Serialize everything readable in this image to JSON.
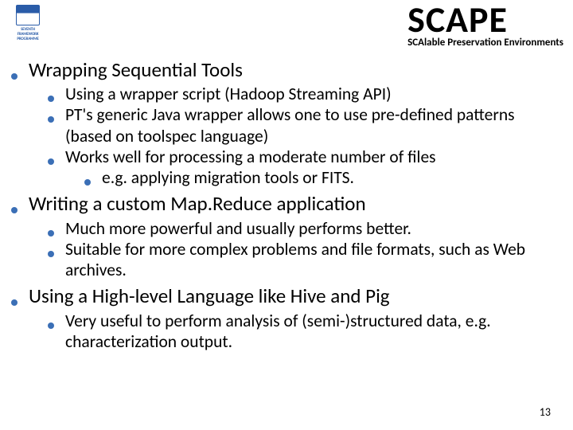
{
  "header": {
    "title": "SCAPE",
    "subtitle": "SCAlable Preservation Environments",
    "logo_caption": "SEVENTH FRAMEWORK PROGRAMME"
  },
  "items": [
    {
      "text": "Wrapping Sequential Tools",
      "children": [
        {
          "text": "Using a wrapper script (Hadoop Streaming API)"
        },
        {
          "text": "PT's generic Java wrapper allows one to use pre-defined patterns (based on toolspec language)"
        },
        {
          "text": "Works well for processing a moderate number of files",
          "children": [
            {
              "text": "e.g. applying migration tools or FITS."
            }
          ]
        }
      ]
    },
    {
      "text": "Writing a custom Map.Reduce application",
      "children": [
        {
          "text": "Much more powerful and usually performs better."
        },
        {
          "text": "Suitable for more complex problems and file formats, such as Web archives."
        }
      ]
    },
    {
      "text": "Using a High-level Language like Hive and Pig",
      "children": [
        {
          "text": "Very useful to perform analysis of (semi-)structured data, e.g. characterization output."
        }
      ]
    }
  ],
  "page_number": "13"
}
